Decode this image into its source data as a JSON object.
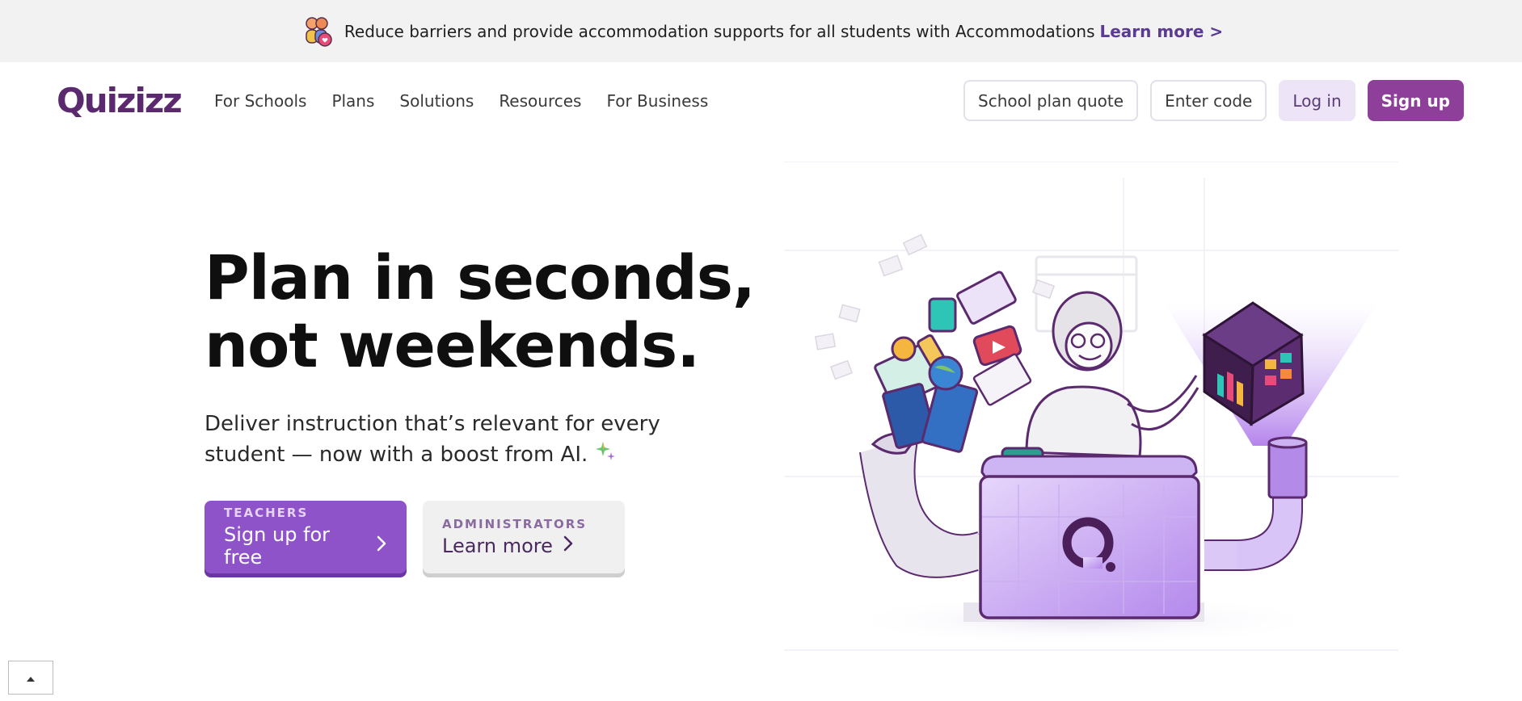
{
  "banner": {
    "text": "Reduce barriers and provide accommodation supports for all students with Accommodations",
    "link": "Learn more >",
    "icon": "accommodations-people-icon"
  },
  "nav": {
    "logo": "Quizizz",
    "links": [
      "For Schools",
      "Plans",
      "Solutions",
      "Resources",
      "For Business"
    ],
    "school_quote": "School plan quote",
    "enter_code": "Enter code",
    "login": "Log in",
    "signup": "Sign up"
  },
  "hero": {
    "title_line1": "Plan in seconds,",
    "title_line2": "not weekends.",
    "subtitle_line1": "Deliver instruction that’s relevant for every",
    "subtitle_line2": "student — now with a boost from AI.",
    "cta_teachers": {
      "kicker": "TEACHERS",
      "label": "Sign up for free"
    },
    "cta_admin": {
      "kicker": "ADMINISTRATORS",
      "label": "Learn more"
    }
  },
  "colors": {
    "brand": "#8d3f99",
    "teachers_cta": "#8f53c9",
    "banner_link": "#5b3a91"
  },
  "illustration": {
    "icon": "teacher-quiz-machine-illustration"
  },
  "back_to_top": {
    "icon": "caret-up-icon"
  }
}
